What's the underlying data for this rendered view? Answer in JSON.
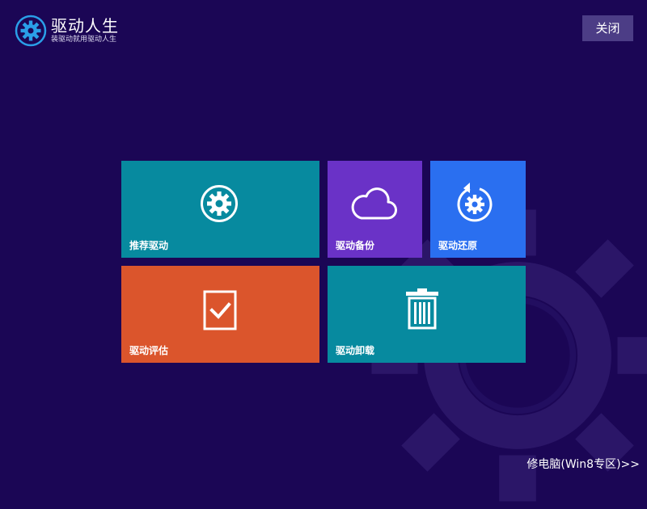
{
  "header": {
    "app_title": "驱动人生",
    "app_subtitle": "装驱动就用驱动人生",
    "close_label": "关闭"
  },
  "tiles": [
    {
      "label": "推荐驱动",
      "icon": "gear-icon",
      "color": "#078a9f"
    },
    {
      "label": "驱动备份",
      "icon": "cloud-icon",
      "color": "#6a32c7"
    },
    {
      "label": "驱动还原",
      "icon": "restore-gear-icon",
      "color": "#2a6ff0"
    },
    {
      "label": "驱动评估",
      "icon": "checkbox-icon",
      "color": "#db552c"
    },
    {
      "label": "驱动卸载",
      "icon": "trash-icon",
      "color": "#078a9f"
    }
  ],
  "footer": {
    "link_label": "修电脑(Win8专区)>>"
  },
  "colors": {
    "background": "#1b0655",
    "accent": "#2a9fe8",
    "close_button": "#4c3d86"
  }
}
